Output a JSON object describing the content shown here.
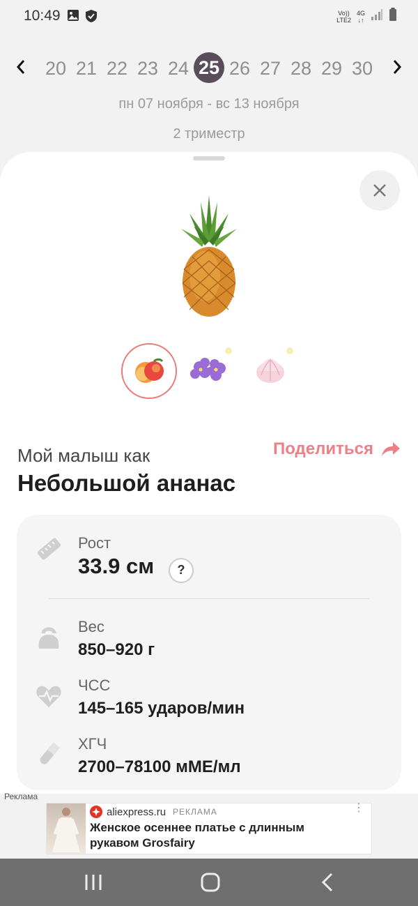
{
  "status_bar": {
    "time": "10:49",
    "net_top": "Vo))",
    "net_bottom": "LTE2",
    "net4g": "4G"
  },
  "weeks": {
    "items": [
      "20",
      "21",
      "22",
      "23",
      "24",
      "25",
      "26",
      "27",
      "28",
      "29",
      "30"
    ],
    "active": "25",
    "date_range": "пн 07 ноября - вс 13 ноября",
    "trimester": "2 триместр"
  },
  "baby": {
    "label": "Мой малыш как",
    "name": "Небольшой ананас",
    "share": "Поделиться"
  },
  "metrics": {
    "height": {
      "label": "Рост",
      "value": "33.9 см",
      "help": "?"
    },
    "weight": {
      "label": "Вес",
      "value": "850–920 г"
    },
    "heart_rate": {
      "label": "ЧСС",
      "value": "145–165 ударов/мин"
    },
    "hcg": {
      "label": "ХГЧ",
      "value": "2700–78100 мМЕ/мл"
    }
  },
  "ad": {
    "label": "Реклама",
    "source": "aliexpress.ru",
    "tag": "РЕКЛАМА",
    "title": "Женское осеннее платье с длинным рукавом Grosfairy"
  },
  "colors": {
    "accent": "#ef7f86",
    "active_week": "#5a4c5a",
    "card_bg": "#f5f5f5"
  },
  "icons": {
    "close": "close-icon",
    "share": "share-arrow-icon",
    "height": "ruler-icon",
    "weight": "kettlebell-icon",
    "heart_rate": "heart-pulse-icon",
    "hcg": "test-tube-icon"
  }
}
